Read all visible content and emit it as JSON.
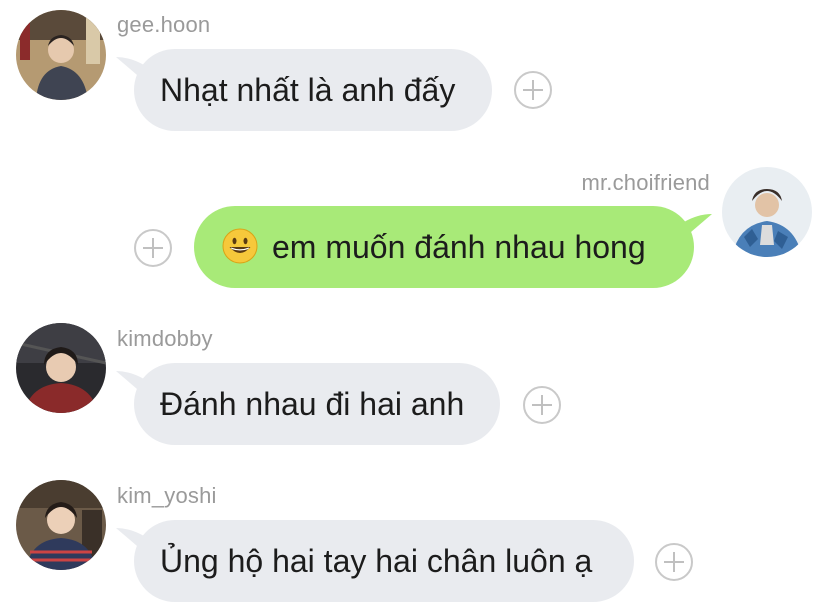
{
  "messages": [
    {
      "sender": "gee.hoon",
      "text": "Nhạt nhất là anh đấy",
      "direction": "incoming"
    },
    {
      "sender": "mr.choifriend",
      "text": "em muốn đánh nhau hong",
      "direction": "outgoing",
      "emoji": "grinning-face"
    },
    {
      "sender": "kimdobby",
      "text": "Đánh nhau đi hai anh",
      "direction": "incoming"
    },
    {
      "sender": "kim_yoshi",
      "text": "Ủng hộ hai tay hai chân luôn ạ",
      "direction": "incoming"
    }
  ],
  "colors": {
    "incoming_bubble": "#e9ebef",
    "outgoing_bubble": "#a8ea78",
    "username": "#9a9a9a",
    "text": "#1c1c1c"
  },
  "icons": {
    "react_button": "plus-circle-icon"
  }
}
